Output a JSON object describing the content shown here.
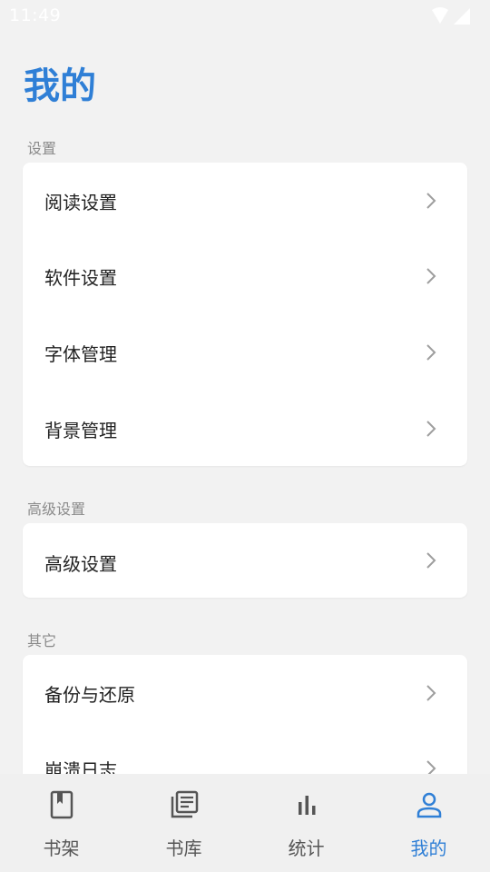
{
  "status_bar": {
    "time": "11:49",
    "icons": [
      "wifi-icon",
      "cell-signal-icon"
    ]
  },
  "header": {
    "title": "我的"
  },
  "sections": [
    {
      "label": "设置",
      "items": [
        {
          "label": "阅读设置"
        },
        {
          "label": "软件设置"
        },
        {
          "label": "字体管理"
        },
        {
          "label": "背景管理"
        }
      ]
    },
    {
      "label": "高级设置",
      "items": [
        {
          "label": "高级设置"
        }
      ]
    },
    {
      "label": "其它",
      "items": [
        {
          "label": "备份与还原"
        },
        {
          "label": "崩溃日志"
        }
      ]
    }
  ],
  "bottom_nav": {
    "items": [
      {
        "label": "书架",
        "icon": "bookshelf-icon",
        "active": false
      },
      {
        "label": "书库",
        "icon": "library-icon",
        "active": false
      },
      {
        "label": "统计",
        "icon": "stats-icon",
        "active": false
      },
      {
        "label": "我的",
        "icon": "profile-icon",
        "active": true
      }
    ]
  },
  "colors": {
    "accent": "#2f7fd6",
    "background": "#f2f2f2",
    "card": "#ffffff",
    "section_label": "#8a8a8a",
    "nav_inactive": "#555555"
  }
}
